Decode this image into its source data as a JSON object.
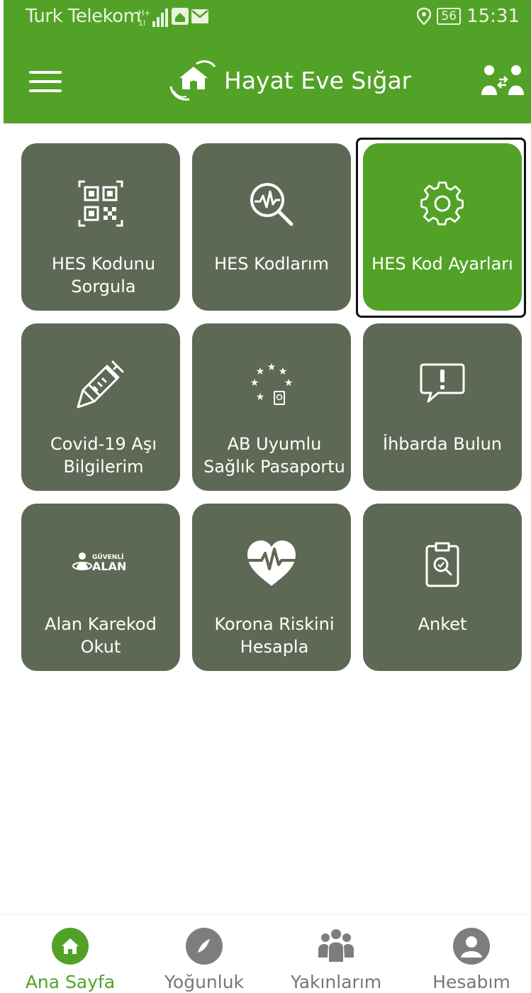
{
  "status_bar": {
    "carrier": "Turk Telekom",
    "battery": "56",
    "time": "15:31"
  },
  "app_bar": {
    "title": "Hayat Eve Sığar",
    "menu_icon": "hamburger-menu-icon",
    "logo_icon": "house-hands-logo",
    "right_icon": "account-switch-icon"
  },
  "tiles": [
    {
      "label": "HES Kodunu Sorgula",
      "icon": "qr-code-icon",
      "selected": false
    },
    {
      "label": "HES Kodlarım",
      "icon": "search-pulse-icon",
      "selected": false
    },
    {
      "label": "HES Kod Ayarları",
      "icon": "gear-icon",
      "selected": true
    },
    {
      "label": "Covid-19 Aşı Bilgilerim",
      "icon": "syringe-icon",
      "selected": false
    },
    {
      "label": "AB Uyumlu Sağlık Pasaportu",
      "icon": "eu-passport-icon",
      "selected": false
    },
    {
      "label": "İhbarda Bulun",
      "icon": "exclamation-bubble-icon",
      "selected": false
    },
    {
      "label": "Alan Karekod Okut",
      "icon": "guvenli-alan-logo",
      "selected": false
    },
    {
      "label": "Korona Riskini Hesapla",
      "icon": "heart-pulse-icon",
      "selected": false
    },
    {
      "label": "Anket",
      "icon": "clipboard-search-icon",
      "selected": false
    }
  ],
  "guvenli_alan_logo_text": {
    "line1": "GÜVENLİ",
    "line2": "ALAN"
  },
  "bottom_nav": [
    {
      "label": "Ana Sayfa",
      "icon": "home-icon",
      "active": true
    },
    {
      "label": "Yoğunluk",
      "icon": "compass-icon",
      "active": false
    },
    {
      "label": "Yakınlarım",
      "icon": "group-icon",
      "active": false
    },
    {
      "label": "Hesabım",
      "icon": "user-icon",
      "active": false
    }
  ],
  "colors": {
    "brand_green": "#52a227",
    "tile_gray": "#5d6955",
    "nav_inactive": "#7d7d7d"
  }
}
